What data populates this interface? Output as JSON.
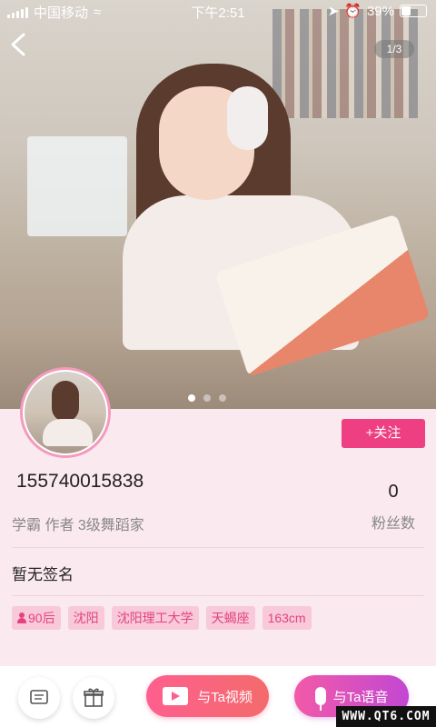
{
  "status_bar": {
    "carrier": "中国移动",
    "time": "下午2:51",
    "battery": "39%"
  },
  "gallery": {
    "counter": "1/3",
    "total_dots": 3,
    "active_dot": 1
  },
  "profile": {
    "follow_label": "+关注",
    "name": "155740015838",
    "tags_line": "学霸 作者 3级舞蹈家",
    "fans_count": "0",
    "fans_label": "粉丝数",
    "signature": "暂无签名",
    "chips": [
      "90后",
      "沈阳",
      "沈阳理工大学",
      "天蝎座",
      "163cm"
    ]
  },
  "bottom_bar": {
    "video_label": "与Ta视频",
    "voice_label": "与Ta语音"
  },
  "watermark": "WWW.QT6.COM",
  "colors": {
    "accent": "#ee3f82",
    "chip_bg": "#f7c9d9",
    "chip_text": "#e3447f",
    "page_bg": "#fbe9f0"
  }
}
